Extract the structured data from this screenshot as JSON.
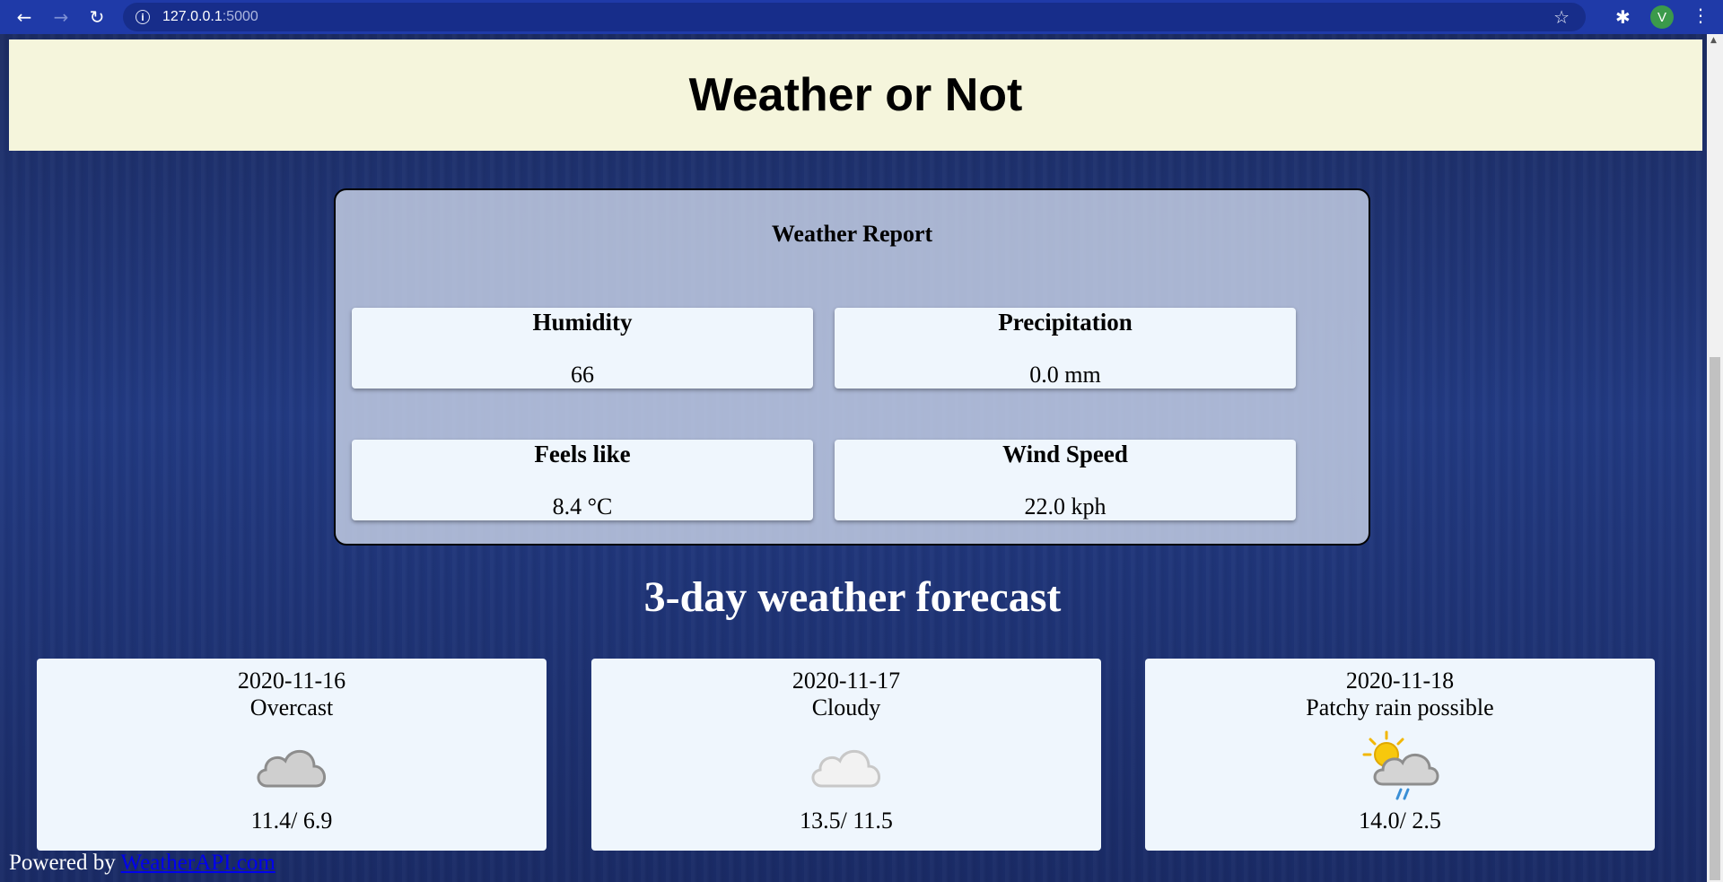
{
  "browser": {
    "url_host": "127.0.0.1",
    "url_port": ":5000",
    "avatar_letter": "V"
  },
  "header": {
    "title": "Weather or Not"
  },
  "report": {
    "title": "Weather Report",
    "stats": [
      {
        "label": "Humidity",
        "value": "66"
      },
      {
        "label": "Precipitation",
        "value": "0.0 mm"
      },
      {
        "label": "Feels like",
        "value": "8.4 °C"
      },
      {
        "label": "Wind Speed",
        "value": "22.0 kph"
      }
    ]
  },
  "forecast": {
    "title": "3-day weather forecast",
    "days": [
      {
        "date": "2020-11-16",
        "condition": "Overcast",
        "icon": "overcast-icon",
        "temps": "11.4/ 6.9"
      },
      {
        "date": "2020-11-17",
        "condition": "Cloudy",
        "icon": "cloudy-icon",
        "temps": "13.5/ 11.5"
      },
      {
        "date": "2020-11-18",
        "condition": "Patchy rain possible",
        "icon": "patchy-rain-icon",
        "temps": "14.0/ 2.5"
      }
    ]
  },
  "footer": {
    "prefix": "Powered by",
    "link_text": "WeatherAPI.com"
  }
}
